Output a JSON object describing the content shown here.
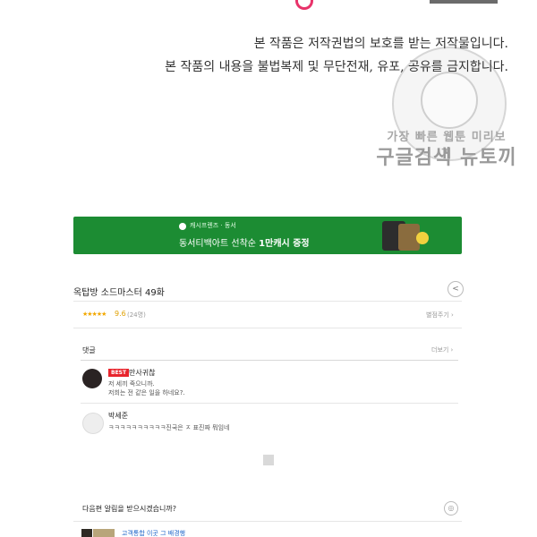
{
  "notice": {
    "line1": "본 작품은 저작권법의 보호를 받는 저작물입니다.",
    "line2": "본 작품의 내용을 불법복제 및 무단전재, 유포, 공유를 금지합니다."
  },
  "watermark": {
    "line1": "가장 빠른 웹툰 미리보기",
    "line2": "구글검색 뉴토끼"
  },
  "banner": {
    "brand": "캐시프렌즈 · 동서",
    "title_prefix": "동서티백아트 선착순 ",
    "title_bold": "1만캐시 증정"
  },
  "episode": {
    "title": "옥탑방 소드마스터 49화",
    "share_icon": "share-icon",
    "stars": "★★★★★",
    "rating": "9.6",
    "rating_count": "(24명)",
    "rate_link": "별점주기 ›"
  },
  "comments": {
    "header": "댓글",
    "more_link": "더보기 ›",
    "items": [
      {
        "badge": "BEST",
        "nickname": "만사귀찮",
        "lines": [
          "저 세끼 죽으니까.",
          "저희는 전 같은 일을 하네요?."
        ]
      },
      {
        "nickname": "박세준",
        "text": "ㅋㅋㅋㅋㅋㅋㅋㅋㅋㅋ진국은 ㅈ 표진짜 뭐임네"
      }
    ]
  },
  "next": {
    "question": "다음편 알림을 받으시겠습니까?",
    "icon": "bell-icon",
    "preview_text": "고객통합 이곳 그 배경행"
  },
  "colors": {
    "banner_bg": "#1c8c33",
    "best_badge": "#e8252d",
    "star": "#f2a800",
    "link_blue": "#1a63c8"
  }
}
